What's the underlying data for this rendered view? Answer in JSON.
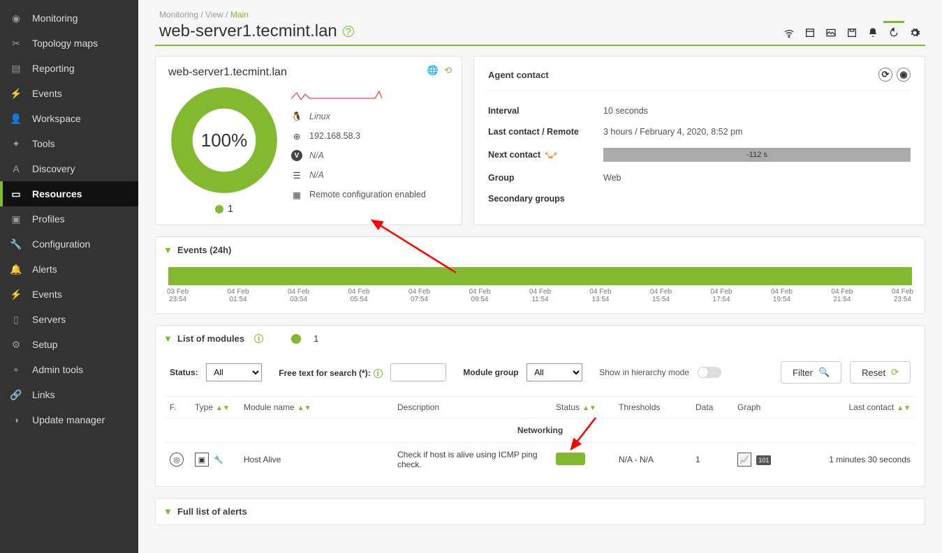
{
  "breadcrumb": {
    "a": "Monitoring",
    "b": "View",
    "c": "Main"
  },
  "page_title": "web-server1.tecmint.lan",
  "sidebar": {
    "items": [
      {
        "label": "Monitoring"
      },
      {
        "label": "Topology maps"
      },
      {
        "label": "Reporting"
      },
      {
        "label": "Events"
      },
      {
        "label": "Workspace"
      },
      {
        "label": "Tools"
      },
      {
        "label": "Discovery"
      },
      {
        "label": "Resources"
      },
      {
        "label": "Profiles"
      },
      {
        "label": "Configuration"
      },
      {
        "label": "Alerts"
      },
      {
        "label": "Events"
      },
      {
        "label": "Servers"
      },
      {
        "label": "Setup"
      },
      {
        "label": "Admin tools"
      },
      {
        "label": "Links"
      },
      {
        "label": "Update manager"
      }
    ]
  },
  "agent_card": {
    "hostname": "web-server1.tecmint.lan",
    "health_pct": "100%",
    "module_count": "1",
    "os": "Linux",
    "ip": "192.168.58.3",
    "version": "N/A",
    "desc": "N/A",
    "remote": "Remote configuration enabled"
  },
  "contact": {
    "title": "Agent contact",
    "interval_label": "Interval",
    "interval_val": "10 seconds",
    "last_label": "Last contact / Remote",
    "last_val": "3 hours / February 4, 2020, 8:52 pm",
    "next_label": "Next contact",
    "next_val": "-112 s",
    "group_label": "Group",
    "group_val": "Web",
    "secgroup_label": "Secondary groups"
  },
  "events24": {
    "title": "Events (24h)",
    "ticks": [
      {
        "d": "03 Feb",
        "t": "23:54"
      },
      {
        "d": "04 Feb",
        "t": "01:54"
      },
      {
        "d": "04 Feb",
        "t": "03:54"
      },
      {
        "d": "04 Feb",
        "t": "05:54"
      },
      {
        "d": "04 Feb",
        "t": "07:54"
      },
      {
        "d": "04 Feb",
        "t": "09:54"
      },
      {
        "d": "04 Feb",
        "t": "11:54"
      },
      {
        "d": "04 Feb",
        "t": "13:54"
      },
      {
        "d": "04 Feb",
        "t": "15:54"
      },
      {
        "d": "04 Feb",
        "t": "17:54"
      },
      {
        "d": "04 Feb",
        "t": "19:54"
      },
      {
        "d": "04 Feb",
        "t": "21:54"
      },
      {
        "d": "04 Feb",
        "t": "23:54"
      }
    ]
  },
  "modules_panel": {
    "title": "List of modules",
    "count": "1",
    "filter": {
      "status_label": "Status:",
      "status_val": "All",
      "search_label": "Free text for search (*):",
      "group_label": "Module group",
      "group_val": "All",
      "hier_label": "Show in hierarchy mode",
      "filter_btn": "Filter",
      "reset_btn": "Reset"
    },
    "headers": {
      "f": "F.",
      "type": "Type",
      "name": "Module name",
      "desc": "Description",
      "status": "Status",
      "thresh": "Thresholds",
      "data": "Data",
      "graph": "Graph",
      "last": "Last contact"
    },
    "group_row": "Networking",
    "row": {
      "name": "Host Alive",
      "desc": "Check if host is alive using ICMP ping check.",
      "thresh": "N/A - N/A",
      "data": "1",
      "last": "1 minutes 30 seconds",
      "badge": "101"
    }
  },
  "alerts_panel": {
    "title": "Full list of alerts"
  },
  "chart_data": {
    "type": "bar",
    "title": "Events (24h)",
    "categories": [
      "03 Feb 23:54",
      "04 Feb 01:54",
      "04 Feb 03:54",
      "04 Feb 05:54",
      "04 Feb 07:54",
      "04 Feb 09:54",
      "04 Feb 11:54",
      "04 Feb 13:54",
      "04 Feb 15:54",
      "04 Feb 17:54",
      "04 Feb 19:54",
      "04 Feb 21:54",
      "04 Feb 23:54"
    ],
    "values": [
      1,
      1,
      1,
      1,
      1,
      1,
      1,
      1,
      1,
      1,
      1,
      1,
      1
    ],
    "xlabel": "",
    "ylabel": "",
    "ylim": [
      0,
      1
    ]
  },
  "colors": {
    "accent": "#82b92e"
  }
}
